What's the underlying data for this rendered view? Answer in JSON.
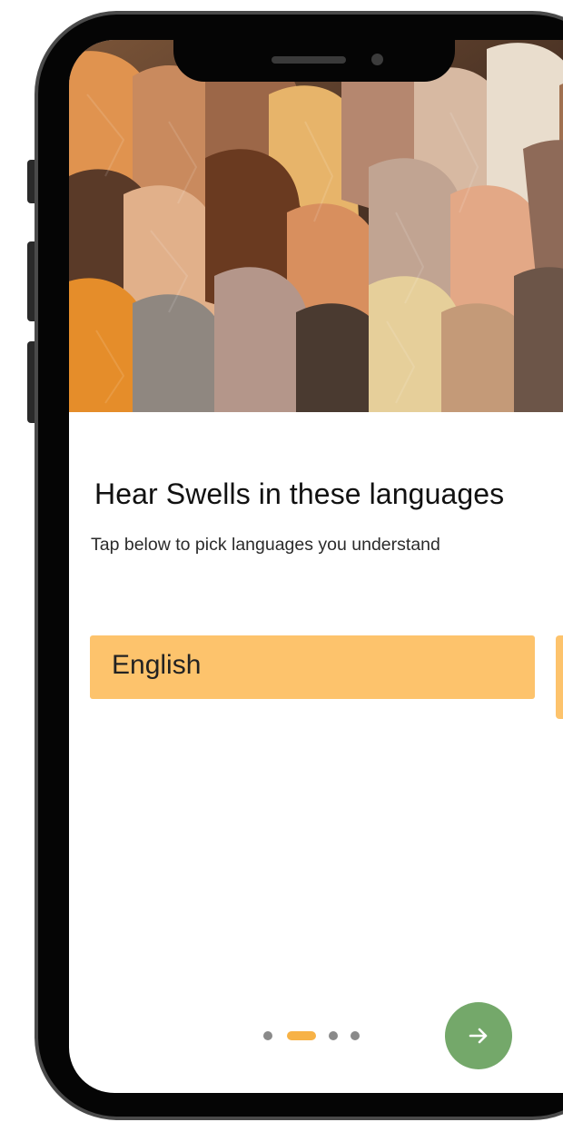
{
  "onboarding": {
    "title": "Hear Swells in these languages",
    "subtitle": "Tap below to pick languages you understand",
    "languages": [
      {
        "label": "English",
        "selected": true
      }
    ],
    "pager": {
      "page_count": 4,
      "current_page": 2
    },
    "next_icon": "arrow-right-icon"
  },
  "colors": {
    "chip": "#fdc36c",
    "pager_active": "#f7b246",
    "pager_inactive": "#8a8a8a",
    "next_button": "#74a86a"
  }
}
